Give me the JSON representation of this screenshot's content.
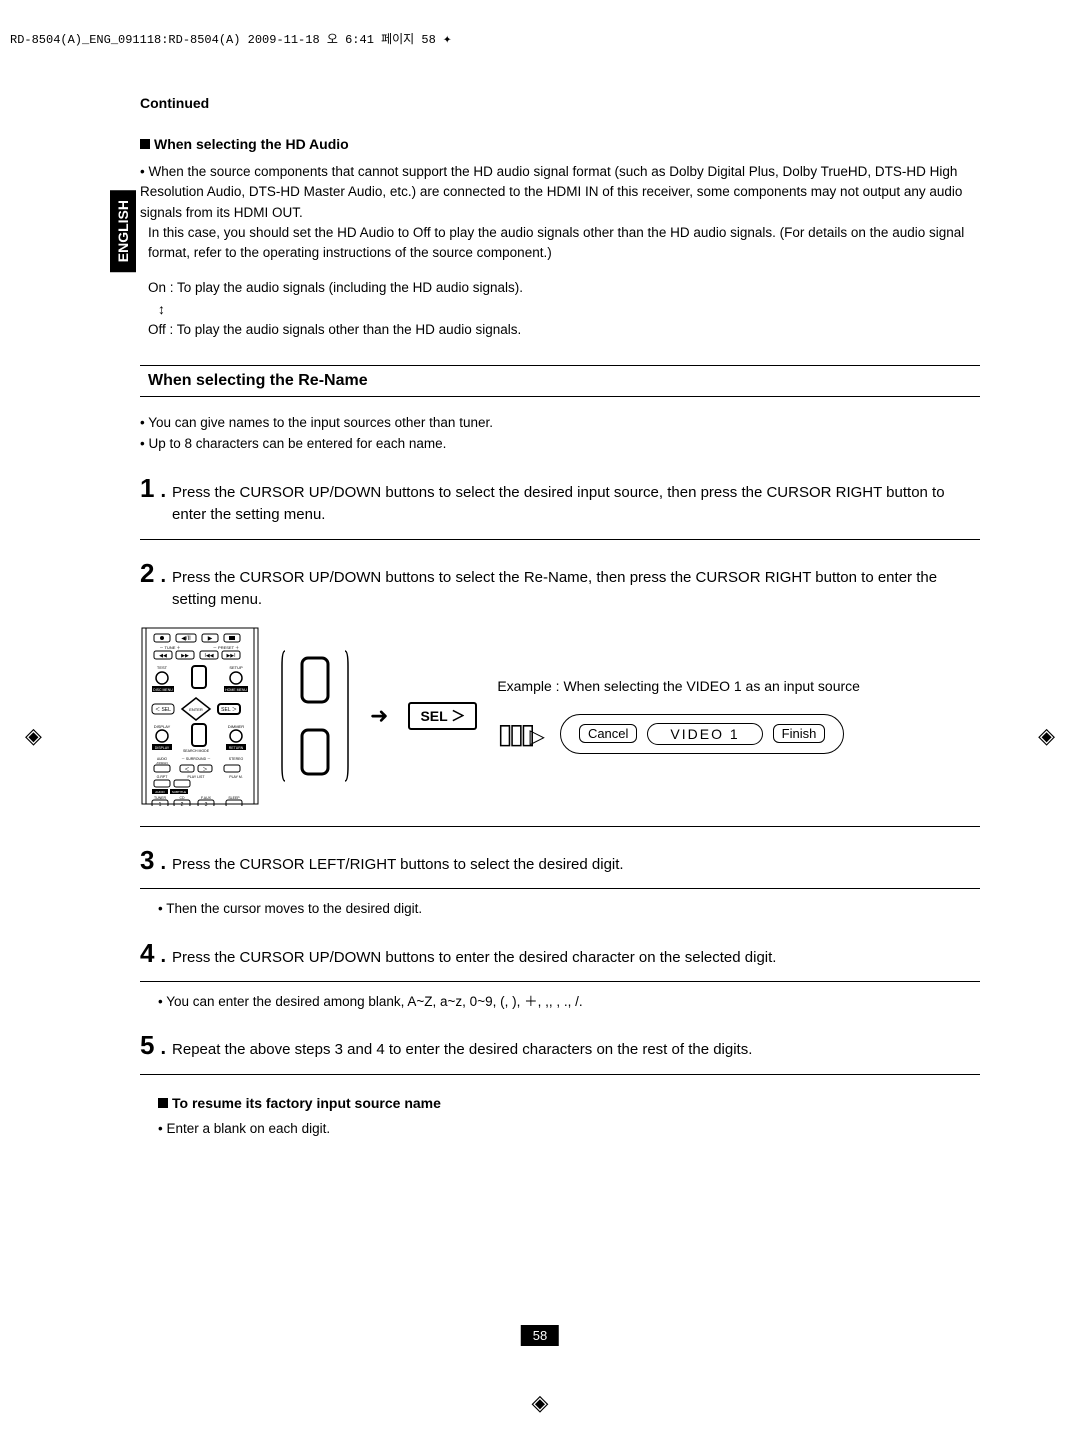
{
  "print_header": "RD-8504(A)_ENG_091118:RD-8504(A)  2009-11-18  오    6:41  페이지 58",
  "side_tab": "ENGLISH",
  "continued": "Continued",
  "hd_audio_heading": "When selecting the HD Audio",
  "hd_audio_body1": "• When the source components that cannot support the HD audio signal format (such as Dolby Digital Plus, Dolby TrueHD, DTS-HD High Resolution Audio, DTS-HD Master Audio, etc.) are connected to the HDMI IN of this receiver, some components may not output any audio signals from its HDMI OUT.",
  "hd_audio_body2": "In this case, you should set the HD Audio to Off to play the audio signals other than the HD audio signals. (For details on the audio signal format, refer to the operating instructions of the source component.)",
  "hd_on": "On : To play the audio signals (including the HD audio signals).",
  "hd_arrow": "↕",
  "hd_off": "Off : To play the audio signals other than the HD audio signals.",
  "rename_header": "When selecting the Re-Name",
  "rename_b1": "• You can give names to the input sources other than tuner.",
  "rename_b2": "• Up to 8 characters can be entered for each name.",
  "step1_num": "1",
  "step1_text": "Press the CURSOR UP/DOWN buttons to select the desired input source, then press the CURSOR RIGHT button to enter the setting menu.",
  "step2_num": "2",
  "step2_text": "Press the CURSOR UP/DOWN buttons to select the Re-Name, then press the CURSOR RIGHT button to enter the setting menu.",
  "example_label": "Example : When selecting the VIDEO 1 as an input source",
  "sel_label": "SEL ＞",
  "lcd_cancel": "Cancel",
  "lcd_video1": "VIDEO 1",
  "lcd_finish": "Finish",
  "step3_num": "3",
  "step3_text": "Press the CURSOR LEFT/RIGHT buttons to select the desired digit.",
  "step3_note": "• Then the cursor moves to the desired digit.",
  "step4_num": "4",
  "step4_text": "Press the CURSOR UP/DOWN buttons to enter the desired character on the selected digit.",
  "step4_note": "• You can enter the desired among blank, A~Z, a~z, 0~9, (, ), ＋, ,,     , ., /.",
  "step5_num": "5",
  "step5_text": "Repeat the above steps 3 and 4 to enter the desired characters on the rest of the digits.",
  "resume_heading": "To resume its factory input source name",
  "resume_body": "• Enter a blank on each digit.",
  "page_num": "58",
  "remote_labels": {
    "tune_minus": "－  TUNE  ＋",
    "preset": "－  PRESET  ＋",
    "test": "TEST",
    "setup": "SETUP",
    "disc_menu": "DISC MENU",
    "home_menu": "HOME MENU",
    "sel_l": "＜ SEL",
    "enter": "ENTER",
    "sel_r": "SEL ＞",
    "display": "DISPLAY",
    "dimmer": "DIMMER",
    "search": "SEARCH MODE",
    "return": "RETURN",
    "audio": "AUDIO ASSIGN",
    "surround": "－ SURROUND －",
    "stereo": "STEREO",
    "grpt": "G.RPT",
    "playlist": "PLAY LIST",
    "playm": "PLAY M.",
    "audio2": "AUDIO",
    "subtitle": "SUBTITLE",
    "tuner": "TUNER",
    "cd": "CD",
    "faux": "F.AUX",
    "sleep": "SLEEP",
    "n1": "1",
    "n2": "2",
    "n3": "3"
  }
}
